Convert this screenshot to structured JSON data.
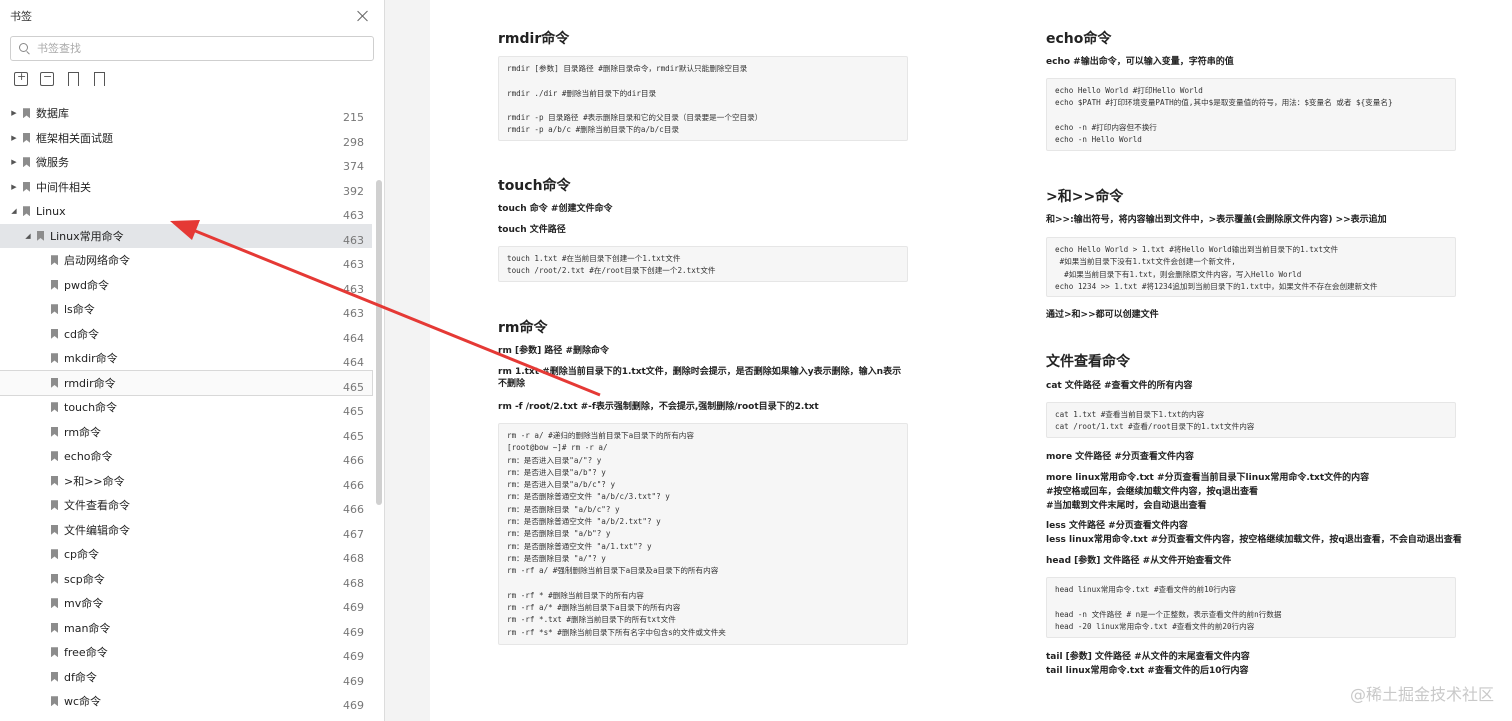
{
  "sidebar": {
    "title": "书签",
    "search_placeholder": "书签查找",
    "items": [
      {
        "label": "数据库",
        "page": "215",
        "level": 0,
        "arrow": "▶"
      },
      {
        "label": "框架相关面试题",
        "page": "298",
        "level": 0,
        "arrow": "▶"
      },
      {
        "label": "微服务",
        "page": "374",
        "level": 0,
        "arrow": "▶"
      },
      {
        "label": "中间件相关",
        "page": "392",
        "level": 0,
        "arrow": "▶"
      },
      {
        "label": "Linux",
        "page": "463",
        "level": 0,
        "arrow": "◢"
      },
      {
        "label": "Linux常用命令",
        "page": "463",
        "level": 1,
        "arrow": "◢",
        "selected": true
      },
      {
        "label": "启动网络命令",
        "page": "463",
        "level": 2,
        "arrow": ""
      },
      {
        "label": "pwd命令",
        "page": "463",
        "level": 2,
        "arrow": ""
      },
      {
        "label": "ls命令",
        "page": "463",
        "level": 2,
        "arrow": ""
      },
      {
        "label": "cd命令",
        "page": "464",
        "level": 2,
        "arrow": ""
      },
      {
        "label": "mkdir命令",
        "page": "464",
        "level": 2,
        "arrow": ""
      },
      {
        "label": "rmdir命令",
        "page": "465",
        "level": 2,
        "arrow": "",
        "hover": true
      },
      {
        "label": "touch命令",
        "page": "465",
        "level": 2,
        "arrow": ""
      },
      {
        "label": "rm命令",
        "page": "465",
        "level": 2,
        "arrow": ""
      },
      {
        "label": "echo命令",
        "page": "466",
        "level": 2,
        "arrow": ""
      },
      {
        "label": ">和>>命令",
        "page": "466",
        "level": 2,
        "arrow": ""
      },
      {
        "label": "文件查看命令",
        "page": "466",
        "level": 2,
        "arrow": ""
      },
      {
        "label": "文件编辑命令",
        "page": "467",
        "level": 2,
        "arrow": ""
      },
      {
        "label": "cp命令",
        "page": "468",
        "level": 2,
        "arrow": ""
      },
      {
        "label": "scp命令",
        "page": "468",
        "level": 2,
        "arrow": ""
      },
      {
        "label": "mv命令",
        "page": "469",
        "level": 2,
        "arrow": ""
      },
      {
        "label": "man命令",
        "page": "469",
        "level": 2,
        "arrow": ""
      },
      {
        "label": "free命令",
        "page": "469",
        "level": 2,
        "arrow": ""
      },
      {
        "label": "df命令",
        "page": "469",
        "level": 2,
        "arrow": ""
      },
      {
        "label": "wc命令",
        "page": "469",
        "level": 2,
        "arrow": ""
      }
    ]
  },
  "doc": {
    "rmdir": {
      "title": "rmdir命令",
      "code": "rmdir [参数] 目录路径 #删除目录命令，rmdir默认只能删除空目录\n\nrmdir ./dir #删除当前目录下的dir目录\n\nrmdir -p 目录路径 #表示删除目录和它的父目录（目录要是一个空目录）\nrmdir -p a/b/c #删除当前目录下的a/b/c目录"
    },
    "touch": {
      "title": "touch命令",
      "p1": "touch 命令 #创建文件命令",
      "p2": "touch 文件路径",
      "code": "touch 1.txt #在当前目录下创建一个1.txt文件\ntouch /root/2.txt #在/root目录下创建一个2.txt文件"
    },
    "rm": {
      "title": "rm命令",
      "p1": "rm [参数] 路径 #删除命令",
      "p2": "rm 1.txt #删除当前目录下的1.txt文件，删除时会提示，是否删除如果输入y表示删除，输入n表示不删除",
      "p3": "rm -f /root/2.txt #-f表示强制删除，不会提示,强制删除/root目录下的2.txt",
      "code": "rm -r a/ #递归的删除当前目录下a目录下的所有内容\n[root@bow ~]# rm -r a/\nrm：是否进入目录\"a/\"? y\nrm：是否进入目录\"a/b\"? y\nrm：是否进入目录\"a/b/c\"? y\nrm：是否删除普通空文件 \"a/b/c/3.txt\"? y\nrm：是否删除目录 \"a/b/c\"? y\nrm：是否删除普通空文件 \"a/b/2.txt\"? y\nrm：是否删除目录 \"a/b\"? y\nrm：是否删除普通空文件 \"a/1.txt\"? y\nrm：是否删除目录 \"a/\"? y\nrm -rf a/ #强制删除当前目录下a目录及a目录下的所有内容\n\nrm -rf * #删除当前目录下的所有内容\nrm -rf a/* #删除当前目录下a目录下的所有内容\nrm -rf *.txt #删除当前目录下的所有txt文件\nrm -rf *s* #删除当前目录下所有名字中包含s的文件或文件夹"
    },
    "echo": {
      "title": "echo命令",
      "p1": "echo #输出命令，可以输入变量，字符串的值",
      "code": "echo Hello World #打印Hello World\necho $PATH #打印环境变量PATH的值,其中$是取变量值的符号，用法：$变量名 或者 ${变量名}\n\necho -n #打印内容但不换行\necho -n Hello World"
    },
    "redirect": {
      "title": ">和>>命令",
      "p1": "和>>:输出符号，将内容输出到文件中，>表示覆盖(会删除原文件内容) >>表示追加",
      "code": "echo Hello World > 1.txt #将Hello World输出到当前目录下的1.txt文件\n #如果当前目录下没有1.txt文件会创建一个新文件,\n  #如果当前目录下有1.txt，则会删除原文件内容，写入Hello World\necho 1234 >> 1.txt #将1234追加到当前目录下的1.txt中，如果文件不存在会创建新文件",
      "p2": "通过>和>>都可以创建文件"
    },
    "view": {
      "title": "文件查看命令",
      "p1": "cat 文件路径 #查看文件的所有内容",
      "code1": "cat 1.txt #查看当前目录下1.txt的内容\ncat /root/1.txt #查看/root目录下的1.txt文件内容",
      "p2": "more 文件路径 #分页查看文件内容",
      "p3": "more linux常用命令.txt #分页查看当前目录下linux常用命令.txt文件的内容",
      "p4": "#按空格或回车，会继续加载文件内容，按q退出查看",
      "p5": "#当加载到文件末尾时，会自动退出查看",
      "p6": "less 文件路径 #分页查看文件内容",
      "p7": "less linux常用命令.txt #分页查看文件内容，按空格继续加载文件，按q退出查看，不会自动退出查看",
      "p8": "head [参数] 文件路径 #从文件开始查看文件",
      "code2": "head linux常用命令.txt #查看文件的前10行内容\n\nhead -n 文件路径 # n是一个正整数，表示查看文件的前n行数据\nhead -20 linux常用命令.txt #查看文件的前20行内容",
      "p9": "tail [参数] 文件路径 #从文件的末尾查看文件内容",
      "p10": "tail linux常用命令.txt #查看文件的后10行内容"
    }
  },
  "watermark": "@稀土掘金技术社区",
  "colors": {
    "annotation_arrow": "#e53935",
    "selected_row": "#e3e5e8"
  }
}
